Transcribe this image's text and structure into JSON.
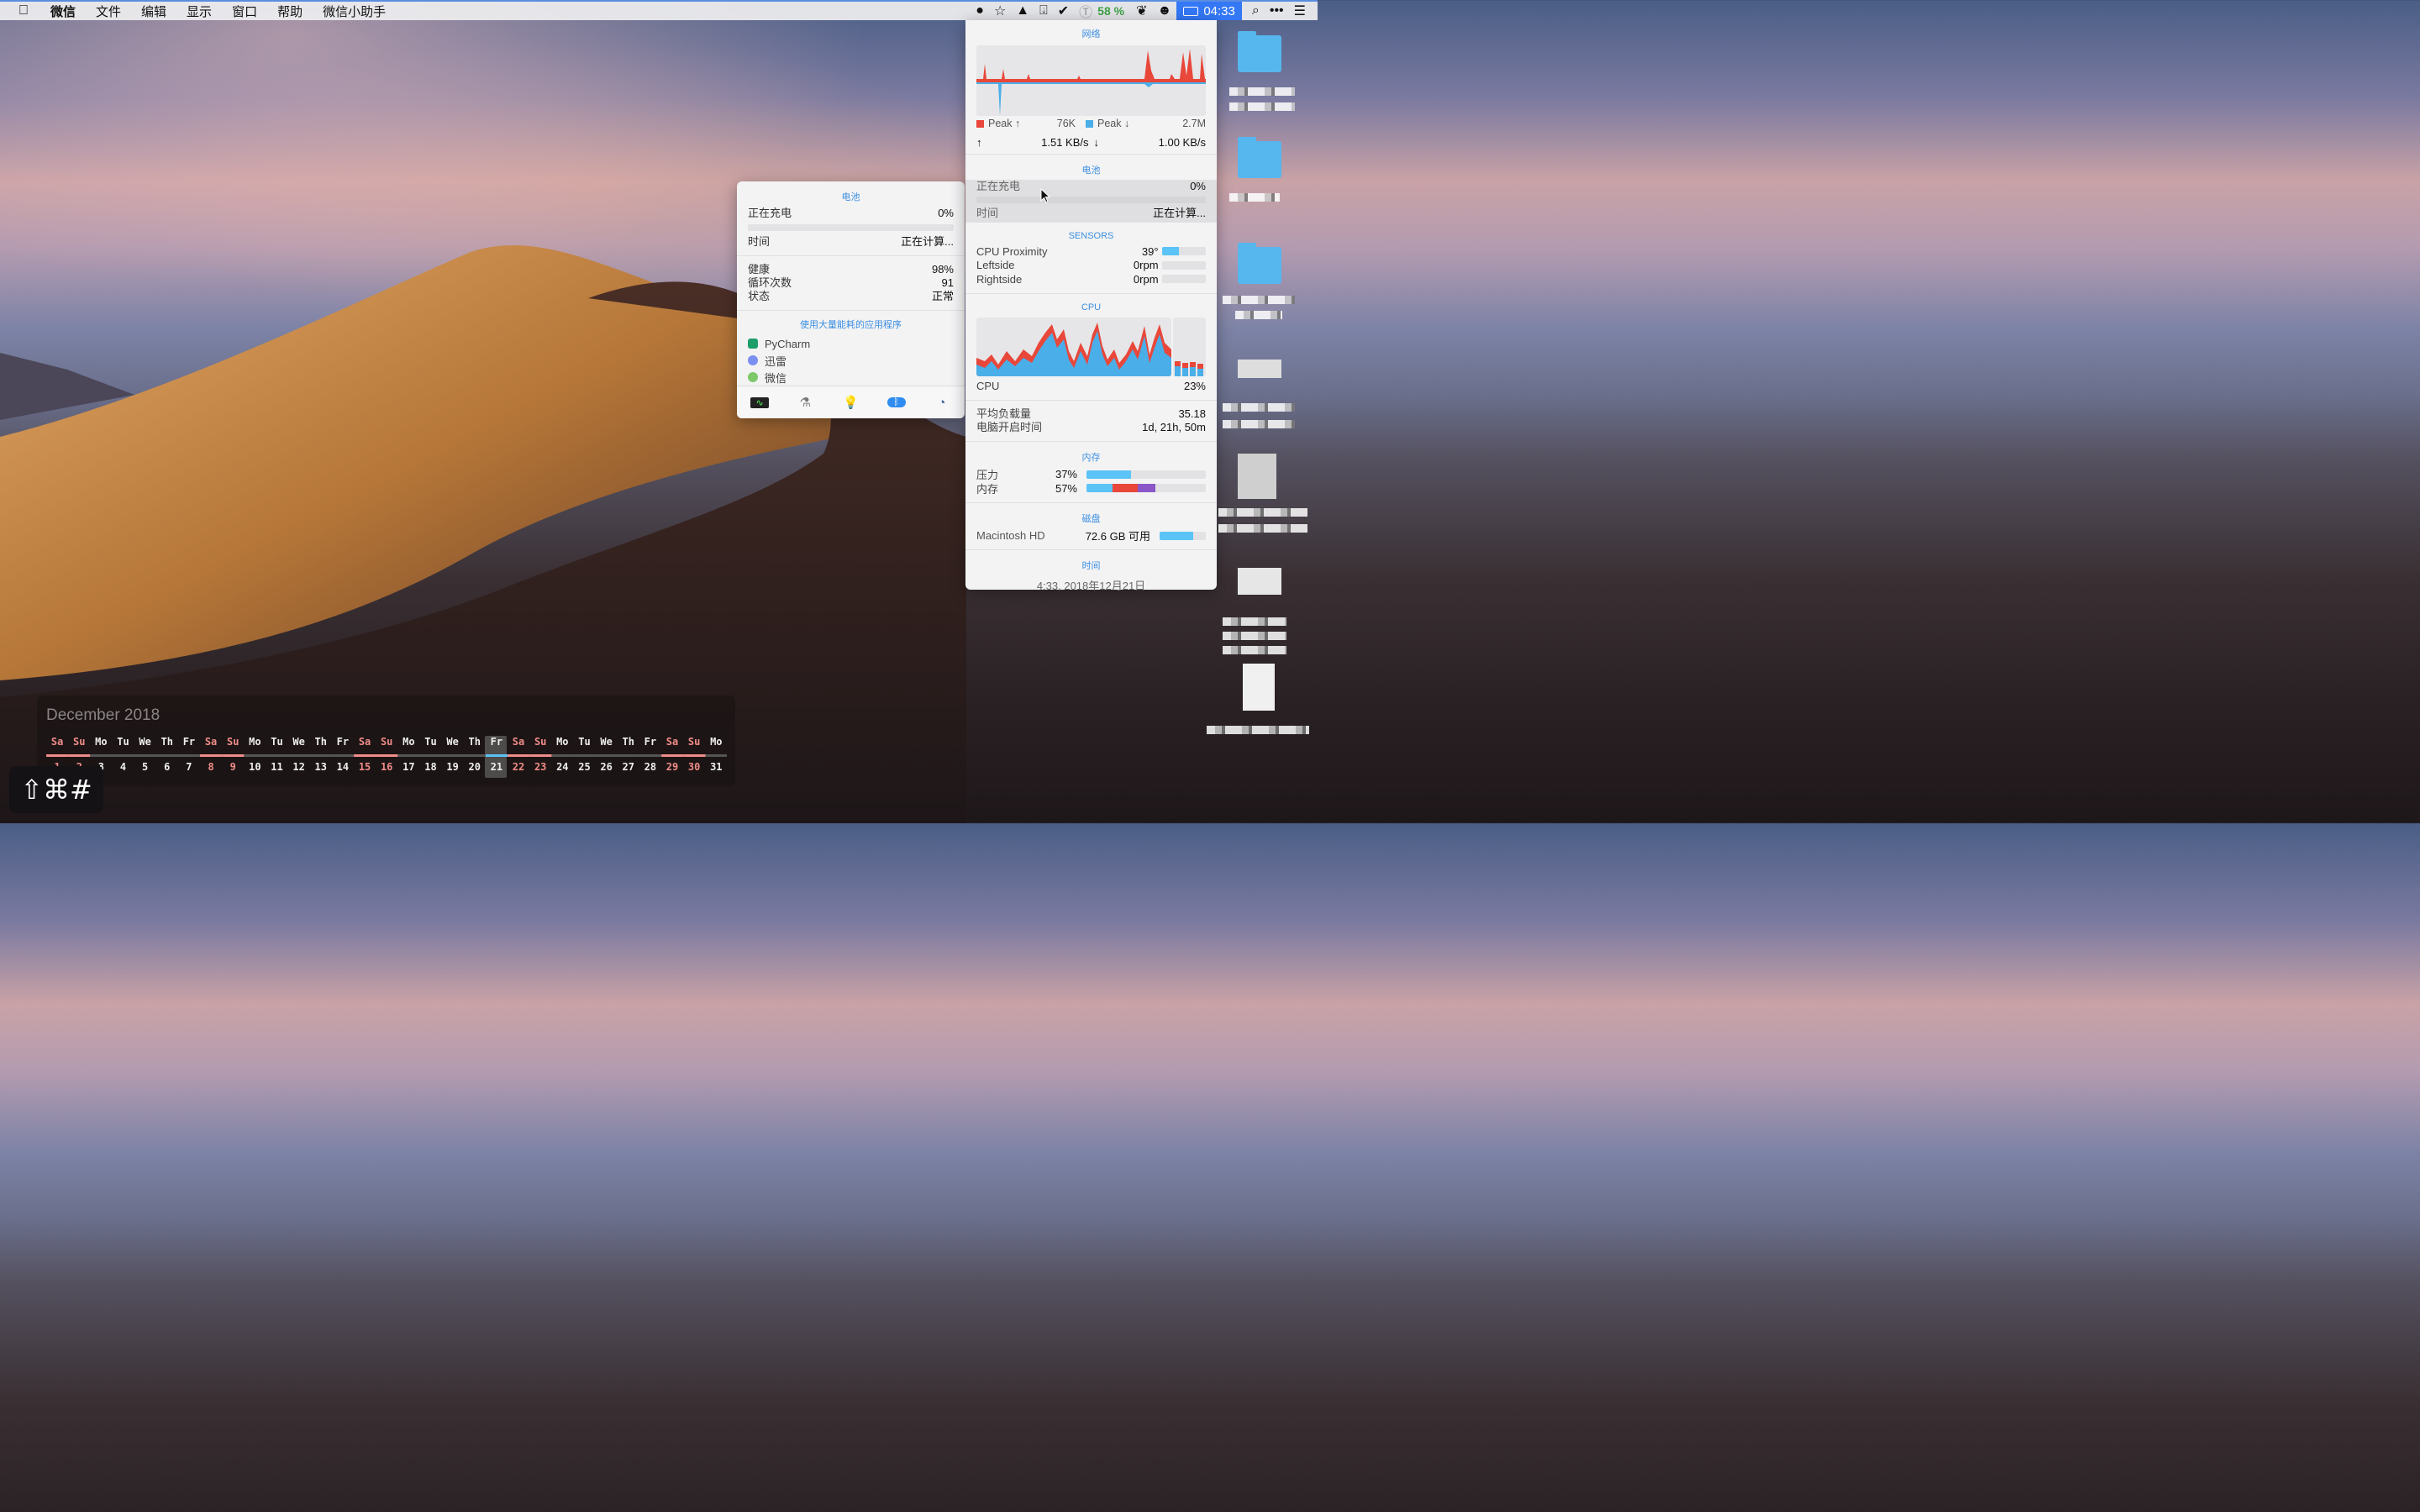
{
  "menubar": {
    "apple": "",
    "items": [
      "微信",
      "文件",
      "编辑",
      "显示",
      "窗口",
      "帮助",
      "微信小助手"
    ],
    "cpu_percent": "58 %",
    "clock": "04:33",
    "icons": [
      "record-dot-icon",
      "star-icon",
      "cloud-upload-icon",
      "download-box-icon",
      "checkmark-circle-icon",
      "timer-icon",
      "butterfly-icon",
      "ghost-icon",
      "battery-icon",
      "search-icon",
      "more-icon",
      "list-icon"
    ]
  },
  "battery_popup": {
    "title": "电池",
    "charging_label": "正在充电",
    "charging_value": "0%",
    "time_label": "时间",
    "time_value": "正在计算...",
    "health_label": "健康",
    "health_value": "98%",
    "cycles_label": "循环次数",
    "cycles_value": "91",
    "status_label": "状态",
    "status_value": "正常",
    "apps_title": "使用大量能耗的应用程序",
    "apps": [
      "PyCharm",
      "迅雷",
      "微信"
    ],
    "footer_icons": [
      "activity-monitor-icon",
      "network-utility-icon",
      "lightbulb-icon",
      "bluetooth-icon",
      "disk-utility-icon"
    ]
  },
  "stats": {
    "network": {
      "title": "网络",
      "peak_up_label": "Peak ↑",
      "peak_up_value": "76K",
      "peak_down_label": "Peak ↓",
      "peak_down_value": "2.7M",
      "up_arrow": "↑",
      "up_speed": "1.51 KB/s",
      "down_arrow": "↓",
      "down_speed": "1.00 KB/s",
      "colors": {
        "up": "#e8473a",
        "down": "#4aaee8"
      }
    },
    "battery": {
      "title": "电池",
      "charging_label": "正在充电",
      "charging_value": "0%",
      "time_label": "时间",
      "time_value": "正在计算..."
    },
    "sensors": {
      "title": "SENSORS",
      "rows": [
        {
          "name": "CPU Proximity",
          "value": "39°",
          "level": 0.39
        },
        {
          "name": "Leftside",
          "value": "0rpm",
          "level": 0
        },
        {
          "name": "Rightside",
          "value": "0rpm",
          "level": 0
        }
      ]
    },
    "cpu": {
      "title": "CPU",
      "label": "CPU",
      "value": "23%",
      "load_label": "平均负载量",
      "load_value": "35.18",
      "uptime_label": "电脑开启时间",
      "uptime_value": "1d, 21h, 50m"
    },
    "memory": {
      "title": "内存",
      "pressure_label": "压力",
      "pressure_value": "37%",
      "pressure_level": 0.37,
      "memory_label": "内存",
      "memory_value": "57%",
      "memory_segments": [
        0.22,
        0.21,
        0.15
      ],
      "segment_colors": [
        "#5bc3f5",
        "#e8473a",
        "#8a56c8"
      ]
    },
    "disk": {
      "title": "磁盘",
      "name": "Macintosh HD",
      "value": "72.6 GB 可用",
      "level": 0.73
    },
    "time": {
      "title": "时间",
      "value": "4:33, 2018年12月21日"
    }
  },
  "calendar": {
    "month": "December 2018",
    "weekdays": [
      "Sa",
      "Su",
      "Mo",
      "Tu",
      "We",
      "Th",
      "Fr",
      "Sa",
      "Su",
      "Mo",
      "Tu",
      "We",
      "Th",
      "Fr",
      "Sa",
      "Su",
      "Mo",
      "Tu",
      "We",
      "Th",
      "Fr",
      "Sa",
      "Su",
      "Mo",
      "Tu",
      "We",
      "Th",
      "Fr",
      "Sa",
      "Su",
      "Mo"
    ],
    "days": [
      "1",
      "2",
      "3",
      "4",
      "5",
      "6",
      "7",
      "8",
      "9",
      "10",
      "11",
      "12",
      "13",
      "14",
      "15",
      "16",
      "17",
      "18",
      "19",
      "20",
      "21",
      "22",
      "23",
      "24",
      "25",
      "26",
      "27",
      "28",
      "29",
      "30",
      "31"
    ],
    "today": "21"
  },
  "hotkey": "⇧⌘#"
}
